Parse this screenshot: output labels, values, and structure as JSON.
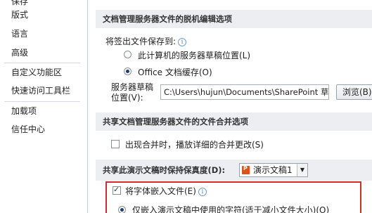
{
  "sidebar": {
    "items": [
      {
        "label": "版式"
      },
      {
        "label": "语言"
      },
      {
        "label": "高级"
      },
      {
        "label": "自定义功能区"
      },
      {
        "label": "快速访问工具栏"
      },
      {
        "label": "加载项"
      },
      {
        "label": "信任中心"
      }
    ]
  },
  "offline": {
    "header": "文档管理服务器文件的脱机编辑选项",
    "save_label": "将签出文件保存到:",
    "radio1_label": "此计算机的服务器草稿位置(L)",
    "radio2_label": "Office 文档缓存(O)",
    "drafts_label_line1": "服务器草稿",
    "drafts_label_line2": "位置(V):",
    "drafts_path": "C:\\Users\\hujun\\Documents\\SharePoint 草稿",
    "browse_label": "浏览(B)..."
  },
  "merge": {
    "header": "共享文档管理服务器文件的文件合并选项",
    "show_changes_label": "出现合并时，播放详细的合并更改(S)"
  },
  "fidelity": {
    "header": "共享此演示文稿时保持保真度(D):",
    "document_name": "演示文稿1",
    "embed_fonts_label": "将字体嵌入文件(E)",
    "embed_option_label": "仅嵌入演示文稿中使用的字符(适于减小文件大小)(O)"
  }
}
